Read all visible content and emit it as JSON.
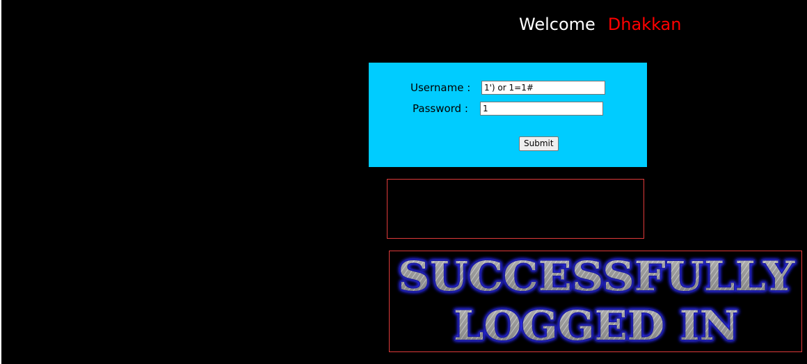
{
  "header": {
    "welcome": "Welcome",
    "name": "Dhakkan"
  },
  "login_form": {
    "username_label": "Username :",
    "username_value": "1') or 1=1#",
    "password_label": "Password :",
    "password_value": "1",
    "submit_label": "Submit"
  },
  "result": {
    "message_text": ""
  },
  "success_banner": {
    "line1": "SUCCESSFULLY",
    "line2": "LOGGED IN"
  },
  "colors": {
    "background": "#000000",
    "form_background": "#00ccff",
    "name_color": "#ff0000",
    "box_border": "#e03a3a",
    "banner_glow": "#2020ff"
  }
}
